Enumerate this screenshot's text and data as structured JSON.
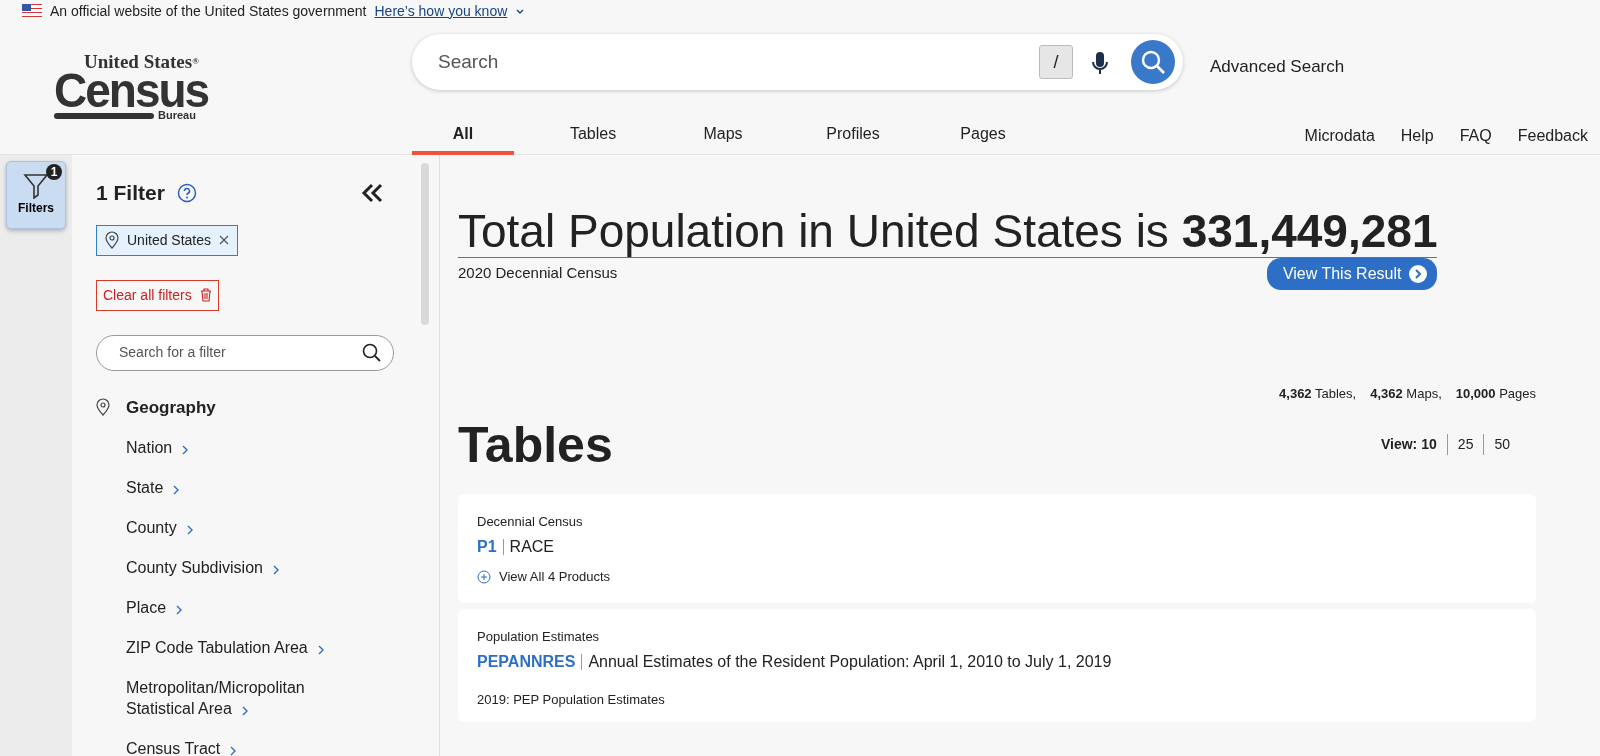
{
  "banner": {
    "text": "An official website of the United States government",
    "link": "Here’s how you know"
  },
  "logo": {
    "line1": "United States",
    "mark": "®",
    "name": "Census",
    "sub": "Bureau"
  },
  "search": {
    "placeholder": "Search",
    "shortcut": "/"
  },
  "advanced_search": "Advanced Search",
  "tabs": [
    {
      "label": "All",
      "selected": true
    },
    {
      "label": "Tables",
      "selected": false
    },
    {
      "label": "Maps",
      "selected": false
    },
    {
      "label": "Profiles",
      "selected": false
    },
    {
      "label": "Pages",
      "selected": false
    }
  ],
  "utility_links": [
    "Microdata",
    "Help",
    "FAQ",
    "Feedback"
  ],
  "filters_button": {
    "label": "Filters",
    "badge": "1"
  },
  "filter_panel": {
    "title": "1 Filter",
    "chips": [
      {
        "label": "United States"
      }
    ],
    "clear_button": "Clear all filters",
    "search_placeholder": "Search for a filter",
    "category": {
      "label": "Geography",
      "items": [
        "Nation",
        "State",
        "County",
        "County Subdivision",
        "Place",
        "ZIP Code Tabulation Area",
        "Metropolitan/Micropolitan Statistical Area",
        "Census Tract"
      ]
    }
  },
  "hero": {
    "headline": "Total Population in United States is **331,449,281**",
    "source": "2020 Decennial Census",
    "button": "View This Result"
  },
  "counts": [
    "**4,362** Tables,",
    "**4,362** Maps,",
    "**10,000** Pages"
  ],
  "section_title": "Tables",
  "view": {
    "label": "View:",
    "options": [
      {
        "label": "10",
        "selected": true
      },
      {
        "label": "25",
        "selected": false
      },
      {
        "label": "50",
        "selected": false
      }
    ]
  },
  "results": [
    {
      "program": "Decennial Census",
      "code": "P1",
      "title": "RACE",
      "extra": {
        "kind": "expand",
        "text": "View All 4 Products"
      }
    },
    {
      "program": "Population Estimates",
      "code": "PEPANNRES",
      "title": "Annual Estimates of the Resident Population: April 1, 2010 to July 1, 2019",
      "extra": {
        "kind": "note",
        "text": "2019: PEP Population Estimates"
      }
    }
  ]
}
